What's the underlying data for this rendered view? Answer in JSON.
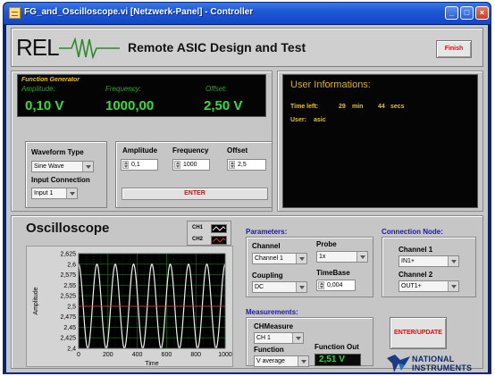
{
  "window": {
    "title": "FG_and_Oscilloscope.vi [Netzwerk-Panel] - Controller"
  },
  "header": {
    "logo_text": "REL",
    "title": "Remote ASIC Design and Test",
    "finish_label": "Finish"
  },
  "function_generator": {
    "heading": "Function Generator",
    "amplitude_label": "Amplitude:",
    "amplitude_value": "0,10  V",
    "frequency_label": "Frequency:",
    "frequency_value": "1000,00",
    "offset_label": "Offset:",
    "offset_value": "2,50  V",
    "waveform_type_label": "Waveform Type",
    "waveform_type_value": "Sine Wave",
    "input_connection_label": "Input Connection",
    "input_connection_value": "Input 1",
    "amplitude_input_label": "Amplitude",
    "amplitude_input_value": "0,1",
    "frequency_input_label": "Frequency",
    "frequency_input_value": "1000",
    "offset_input_label": "Offset",
    "offset_input_value": "2,5",
    "enter_label": "ENTER"
  },
  "user_info": {
    "title": "User Informations:",
    "time_left_label": "Time left:",
    "minutes": "29",
    "min_unit": "min",
    "seconds": "44",
    "sec_unit": "secs",
    "user_label": "User:",
    "user_value": "asic"
  },
  "oscilloscope": {
    "title": "Oscilloscope",
    "legend": {
      "ch1": "CH1",
      "ch2": "CH2"
    },
    "parameters_title": "Parameters:",
    "channel_label": "Channel",
    "channel_value": "Channel 1",
    "probe_label": "Probe",
    "probe_value": "1x",
    "coupling_label": "Coupling",
    "coupling_value": "DC",
    "timebase_label": "TimeBase",
    "timebase_value": "0,004",
    "connection_title": "Connection Node:",
    "channel1_label": "Channel 1",
    "channel1_value": "IN1+",
    "channel2_label": "Channel 2",
    "channel2_value": "OUT1+",
    "measurements_title": "Measurements:",
    "chmeasure_label": "CHMeasure",
    "chmeasure_value": "CH 1",
    "function_label": "Function",
    "function_value": "V average",
    "function_out_label": "Function Out",
    "function_out_value": "2,51  V",
    "enter_update_label": "ENTER/UPDATE",
    "ni_line1": "NATIONAL",
    "ni_line2": "INSTRUMENTS"
  },
  "colors": {
    "ch1": "#f0f0f0",
    "ch2": "#e03030",
    "plot_bg": "#000000",
    "grid": "#1f7a1f",
    "led_green": "#33e033",
    "accent_blue": "#1a1aa0",
    "button_red": "#d01010"
  },
  "chart_data": {
    "type": "line",
    "xlabel": "Time",
    "ylabel": "Amplitude",
    "xlim": [
      0,
      1000
    ],
    "ylim": [
      2.4,
      2.625
    ],
    "x_ticks": [
      "0",
      "200",
      "400",
      "600",
      "800",
      "1000"
    ],
    "y_ticks": [
      "2,4",
      "2,425",
      "2,45",
      "2,475",
      "2,5",
      "2,525",
      "2,55",
      "2,575",
      "2,6",
      "2,625"
    ],
    "series": [
      {
        "name": "CH1",
        "shape": "sine",
        "offset": 2.5,
        "amplitude": 0.1,
        "cycles": 8
      },
      {
        "name": "CH2",
        "shape": "constant",
        "value": 2.5
      }
    ]
  }
}
